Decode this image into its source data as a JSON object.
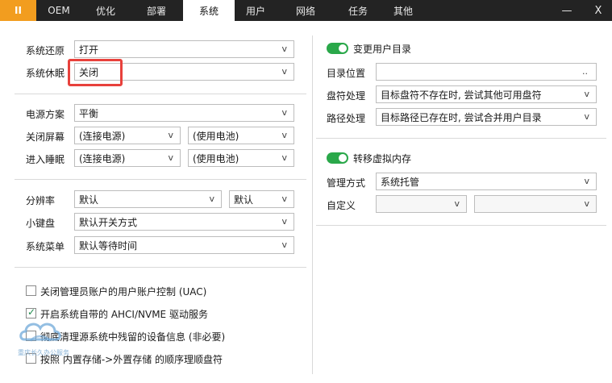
{
  "titlebar": {
    "app_icon": "II",
    "tabs": [
      "OEM",
      "优化",
      "部署",
      "系统",
      "用户",
      "网络",
      "任务",
      "其他"
    ],
    "active_tab": "系统",
    "minimize": "—",
    "close": "X"
  },
  "left": {
    "restore_label": "系统还原",
    "restore_value": "打开",
    "hibernate_label": "系统休眠",
    "hibernate_value": "关闭",
    "power_plan_label": "电源方案",
    "power_plan_value": "平衡",
    "screen_off_label": "关闭屏幕",
    "screen_off_ac": "(连接电源)",
    "screen_off_dc": "(使用电池)",
    "sleep_label": "进入睡眠",
    "sleep_ac": "(连接电源)",
    "sleep_dc": "(使用电池)",
    "resolution_label": "分辨率",
    "resolution_value": "默认",
    "resolution_value2": "默认",
    "keypad_label": "小键盘",
    "keypad_value": "默认开关方式",
    "menu_label": "系统菜单",
    "menu_value": "默认等待时间",
    "checkboxes": [
      {
        "label": "关闭管理员账户的用户账户控制 (UAC)",
        "checked": false
      },
      {
        "label": "开启系统自带的 AHCI/NVME 驱动服务",
        "checked": true
      },
      {
        "label": "彻底清理源系统中残留的设备信息 (非必要)",
        "checked": false
      },
      {
        "label": "按照 内置存储->外置存储 的顺序理顺盘符",
        "checked": false
      }
    ]
  },
  "right": {
    "user_dir_toggle_label": "变更用户目录",
    "dir_location_label": "目录位置",
    "dir_location_btn": "..",
    "drive_handling_label": "盘符处理",
    "drive_handling_value": "目标盘符不存在时, 尝试其他可用盘符",
    "path_handling_label": "路径处理",
    "path_handling_value": "目标路径已存在时, 尝试合并用户目录",
    "vmem_toggle_label": "转移虚拟内存",
    "manage_mode_label": "管理方式",
    "manage_mode_value": "系统托管",
    "custom_label": "自定义"
  },
  "watermark": {
    "text": "重庆长久办公服务"
  },
  "colors": {
    "topbar": "#232323",
    "app_icon": "#f29d1f",
    "toggle_on": "#2aa84a",
    "highlight": "#e8413c"
  }
}
